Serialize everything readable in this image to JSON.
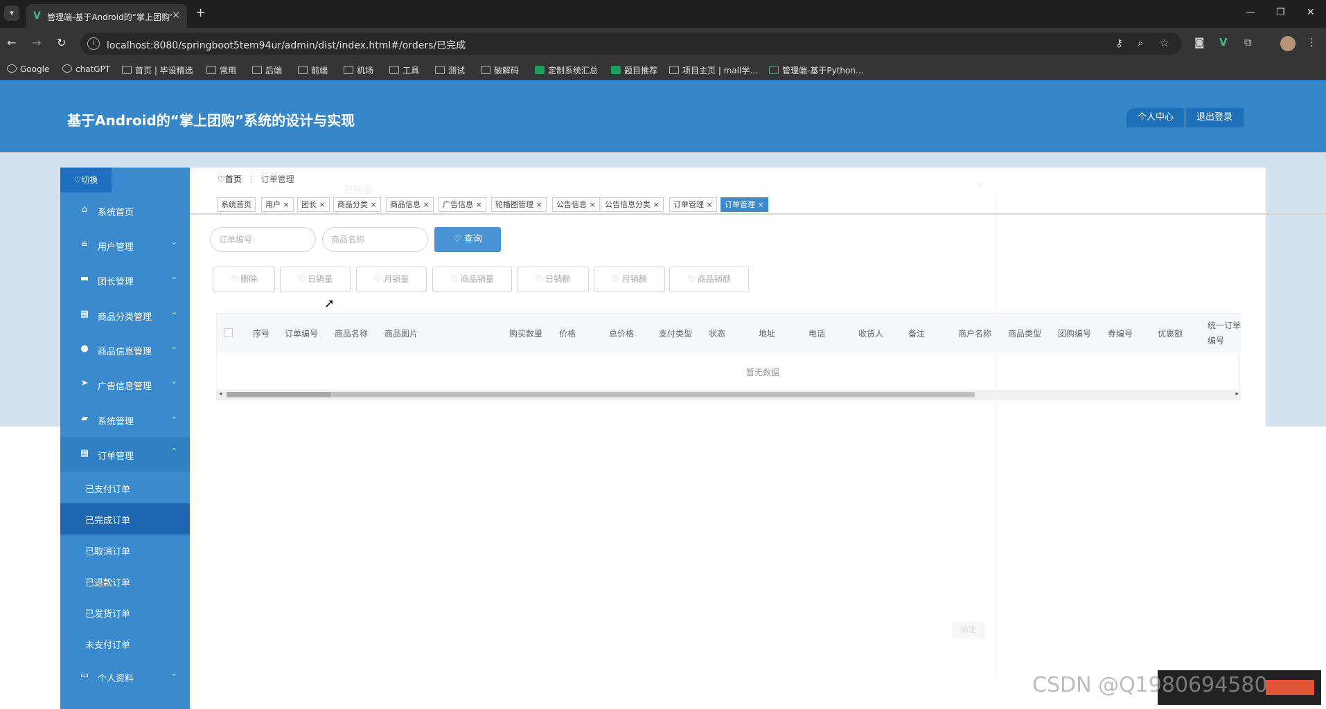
{
  "browser": {
    "tab_title": "管理端-基于Android的“掌上团购”系统的设计与实现",
    "url": "localhost:8080/springboot5tem94ur/admin/dist/index.html#/orders/已完成",
    "bookmarks": [
      "Google",
      "chatGPT",
      "首页 | 毕设精选",
      "常用",
      "后端",
      "前端",
      "机场",
      "工具",
      "测试",
      "破解码",
      "定制系统汇总",
      "题目推荐",
      "项目主页 | mall学...",
      "管理端-基于Python..."
    ]
  },
  "header": {
    "title": "基于Android的“掌上团购”系统的设计与实现",
    "personal_center": "个人中心",
    "logout": "退出登录"
  },
  "sidebar": {
    "switch_label": "♡切换",
    "items": [
      {
        "label": "系统首页",
        "icon": "⌂"
      },
      {
        "label": "用户管理",
        "icon": "≡"
      },
      {
        "label": "团长管理",
        "icon": "▬"
      },
      {
        "label": "商品分类管理",
        "icon": "▦"
      },
      {
        "label": "商品信息管理",
        "icon": "●"
      },
      {
        "label": "广告信息管理",
        "icon": "➤"
      },
      {
        "label": "系统管理",
        "icon": "▰"
      },
      {
        "label": "订单管理",
        "icon": "▦"
      }
    ],
    "sub_items": [
      "已支付订单",
      "已完成订单",
      "已取消订单",
      "已退款订单",
      "已发货订单",
      "未支付订单"
    ],
    "personal": {
      "label": "个人资料",
      "icon": "▭"
    }
  },
  "breadcrumb": {
    "home": "♡首页",
    "current": "订单管理"
  },
  "tags": [
    "系统首页",
    "用户 ×",
    "团长 ×",
    "商品分类 ×",
    "商品信息 ×",
    "广告信息 ×",
    "轮播图管理 ×",
    "公告信息 ×",
    "公告信息分类 ×",
    "订单管理 ×",
    "订单管理 ×"
  ],
  "search": {
    "order_no_placeholder": "订单编号",
    "product_name_placeholder": "商品名称",
    "query_button": "♡ 查询"
  },
  "actions": [
    "♡ 删除",
    "♡ 日销量",
    "♡ 月销量",
    "♡ 商品销量",
    "♡ 日销额",
    "♡ 月销额",
    "♡ 商品销额"
  ],
  "table": {
    "columns": [
      "序号",
      "订单编号",
      "商品名称",
      "商品图片",
      "购买数量",
      "价格",
      "总价格",
      "支付类型",
      "状态",
      "地址",
      "电话",
      "收货人",
      "备注",
      "商户名称",
      "商品类型",
      "团购编号",
      "券编号",
      "优惠额",
      "统一订单",
      "编号"
    ],
    "empty_text": "暂无数据"
  },
  "ghost_dialog": {
    "title": "日销量",
    "close": "×",
    "button": "确定"
  },
  "watermark": "CSDN @Q1980694580",
  "colors": {
    "header": "#3587c9",
    "sidebar": "#3a8ad0",
    "active_sub": "#1f66b0",
    "band": "#d4e1ef"
  }
}
